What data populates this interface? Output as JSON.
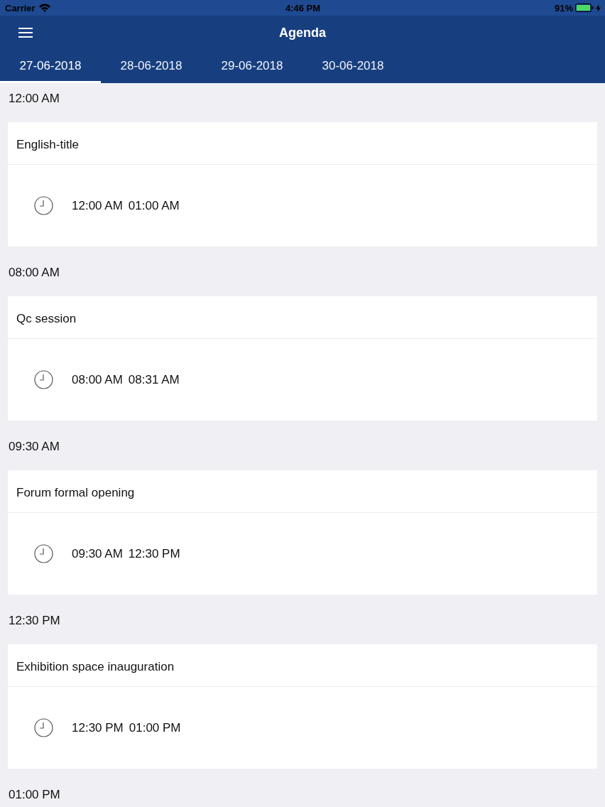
{
  "status_bar": {
    "carrier": "Carrier",
    "time": "4:46 PM",
    "battery": "91%"
  },
  "nav_bar": {
    "title": "Agenda"
  },
  "tabs": [
    {
      "label": "27-06-2018",
      "selected": true
    },
    {
      "label": "28-06-2018",
      "selected": false
    },
    {
      "label": "29-06-2018",
      "selected": false
    },
    {
      "label": "30-06-2018",
      "selected": false
    }
  ],
  "sections": [
    {
      "time": "12:00 AM",
      "sessions": [
        {
          "title": "English-title",
          "start": "12:00 AM",
          "end": "01:00 AM"
        }
      ]
    },
    {
      "time": "08:00 AM",
      "sessions": [
        {
          "title": "Qc session",
          "start": "08:00 AM",
          "end": "08:31 AM"
        }
      ]
    },
    {
      "time": "09:30 AM",
      "sessions": [
        {
          "title": "Forum formal opening",
          "start": "09:30 AM",
          "end": "12:30 PM"
        }
      ]
    },
    {
      "time": "12:30 PM",
      "sessions": [
        {
          "title": "Exhibition space inauguration",
          "start": "12:30 PM",
          "end": "01:00 PM"
        }
      ]
    },
    {
      "time": "01:00 PM"
    }
  ]
}
